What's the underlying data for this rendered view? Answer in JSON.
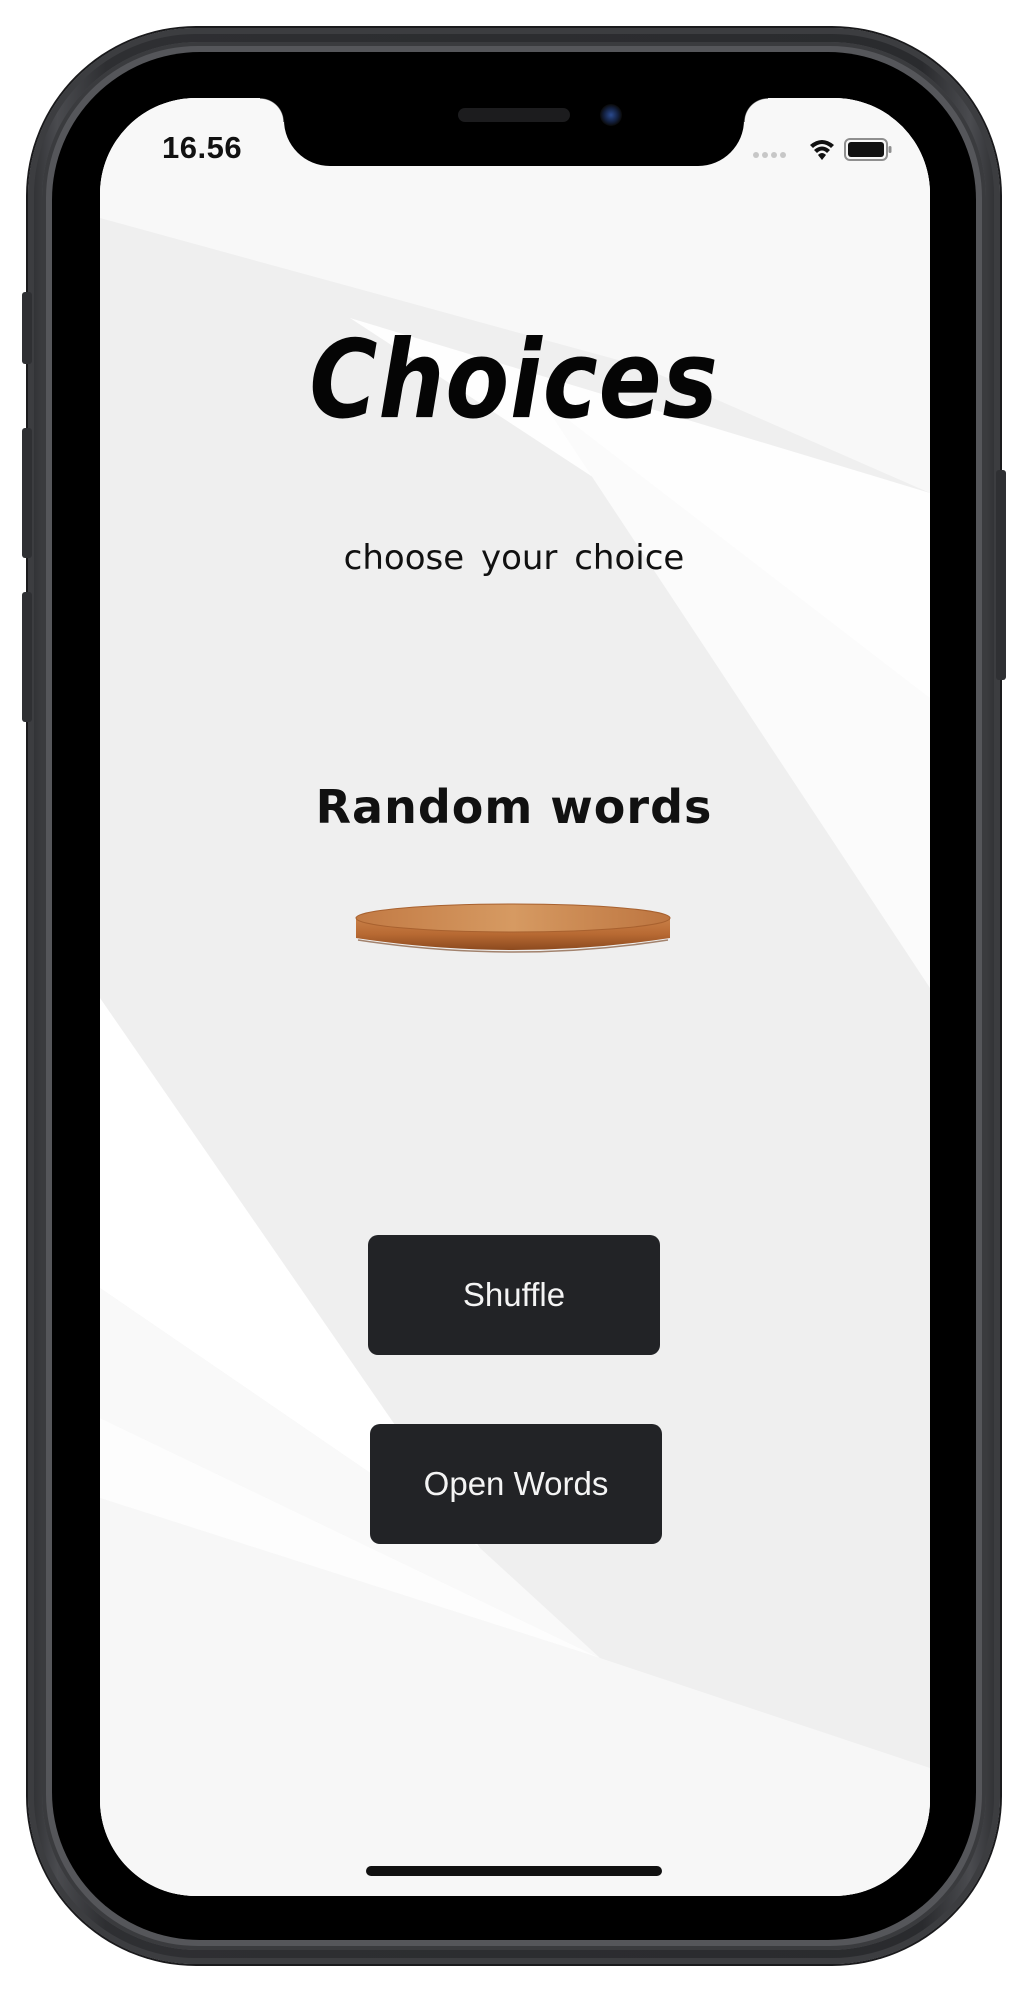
{
  "status_bar": {
    "time": "16.56",
    "signal_icon": "signal-dots-icon",
    "wifi_icon": "wifi-icon",
    "battery_icon": "battery-icon"
  },
  "app": {
    "title": "Choices",
    "subtitle": "choose  your  choice",
    "random_label": "Random words"
  },
  "buttons": {
    "shuffle_label": "Shuffle",
    "open_words_label": "Open Words"
  },
  "colors": {
    "button_background": "#222326",
    "button_text": "#f4f4f4",
    "screen_background": "#efefef",
    "podium_wood": "#b8723c"
  }
}
